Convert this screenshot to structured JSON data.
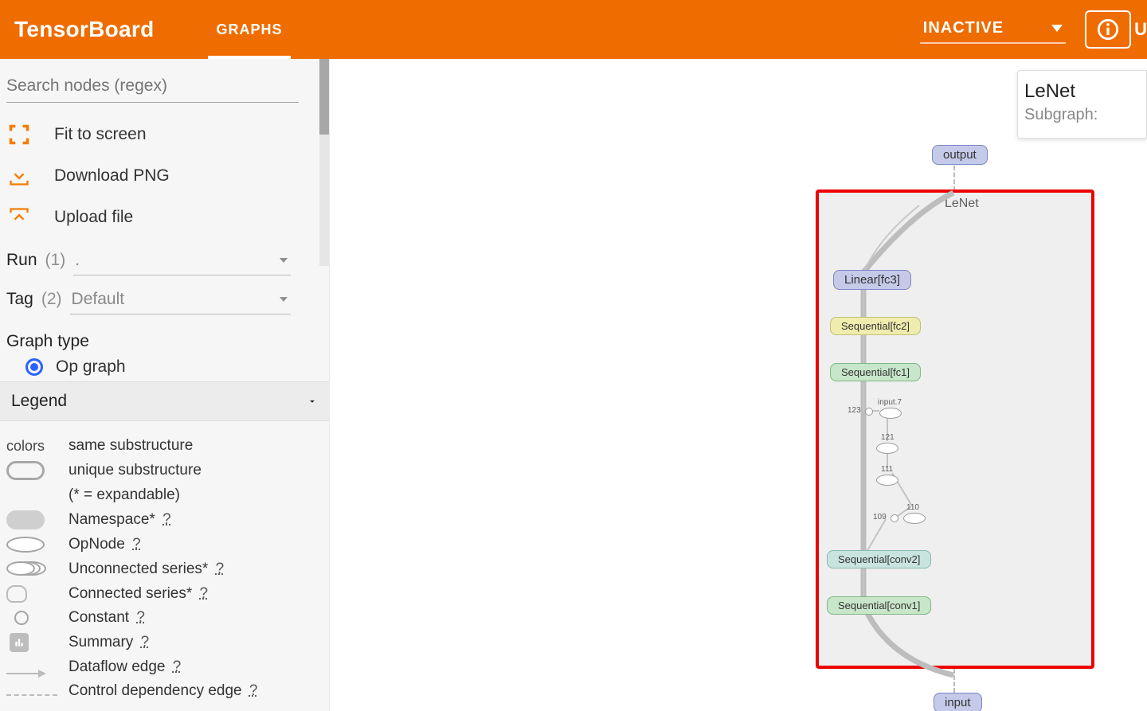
{
  "header": {
    "brand": "TensorBoard",
    "active_tab": "GRAPHS",
    "inactive_label": "INACTIVE",
    "info_button_partial": "U"
  },
  "sidebar": {
    "search_placeholder": "Search nodes (regex)",
    "actions": {
      "fit": "Fit to screen",
      "download": "Download PNG",
      "upload": "Upload file"
    },
    "run": {
      "label": "Run",
      "count": "(1)",
      "value": "."
    },
    "tag": {
      "label": "Tag",
      "count": "(2)",
      "value": "Default"
    },
    "graph_type_label": "Graph type",
    "graph_type_option": "Op graph"
  },
  "legend": {
    "title": "Legend",
    "colors_label": "colors",
    "same_sub": "same substructure",
    "unique_sub": "unique substructure",
    "expandable_note": "(* = expandable)",
    "namespace": "Namespace*",
    "opnode": "OpNode",
    "unconnected": "Unconnected series*",
    "connected": "Connected series*",
    "constant": "Constant",
    "summary": "Summary",
    "dataflow": "Dataflow edge",
    "control_dep": "Control dependency edge",
    "help": "?"
  },
  "graph": {
    "container_label": "LeNet",
    "nodes": {
      "output": "output",
      "input": "input",
      "linear_fc3": "Linear[fc3]",
      "seq_fc2": "Sequential[fc2]",
      "seq_fc1": "Sequential[fc1]",
      "seq_conv2": "Sequential[conv2]",
      "seq_conv1": "Sequential[conv1]",
      "input7": "input.7",
      "n123": "123",
      "n121": "121",
      "n111": "111",
      "n110": "110",
      "n109": "109"
    }
  },
  "infocard": {
    "title": "LeNet",
    "subtitle": "Subgraph:"
  }
}
